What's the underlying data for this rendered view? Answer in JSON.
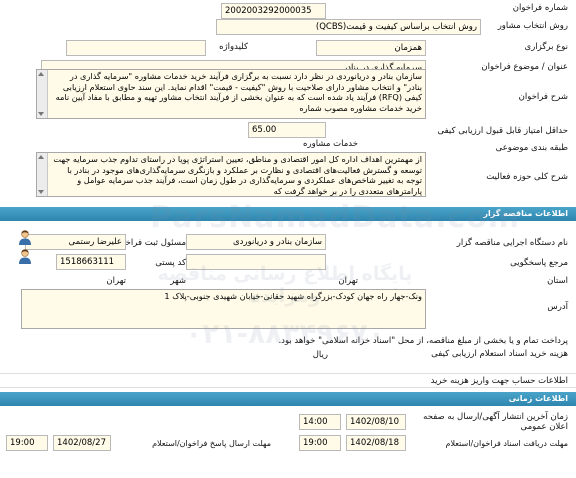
{
  "form": {
    "tender_number": {
      "label": "شماره فراخوان",
      "value": "2002003292000035"
    },
    "consultant_selection": {
      "label": "روش انتخاب مشاور",
      "value": "روش انتخاب براساس کیفیت و قیمت(QCBS)"
    },
    "holding_type": {
      "label": "نوع برگزاری",
      "value": "همزمان",
      "keyword_label": "کلیدواژه",
      "keyword_value": ""
    },
    "title": {
      "label": "عنوان / موضوع فراخوان",
      "value": "سرمایه گذاری در بنادر"
    },
    "description": {
      "label": "شرح فراخوان",
      "text": "سازمان بنادر و دریانوردی در نظر دارد نسبت به برگزاری فرآیند خرید خدمات مشاوره \"سرمایه گذاری در بنادر\" و انتخاب مشاور دارای صلاحیت با روش \"کیفیت - قیمت\" اقدام نماید. این سند حاوی استعلام ارزیابی کیفی (RFQ) فرآیند یاد شده است که به عنوان بخشی از فرآیند انتخاب مشاور تهیه و مطابق با مفاد آیین نامه خرید خدمات مشاوره مصوب شماره"
    },
    "min_quality_score": {
      "label": "حداقل امتیاز قابل قبول ارزیابی کیفی",
      "value": "65.00"
    },
    "subject_class": {
      "label": "طبقه بندی موضوعی",
      "value": "خدمات مشاوره"
    },
    "activity_scope": {
      "label": "شرح کلی حوزه فعالیت",
      "text": "از مهمترین اهداف اداره کل امور اقتصادی و مناطق، تعیین استراتژی پویا در راستای تداوم جذب سرمایه جهت توسعه و گسترش فعالیت‌های اقتصادی و نظارت بر عملکرد و بازنگری سرمایه‌گذاری‌های موجود در بنادر با توجه به تغییر شاخص‌های عملکردی و سرمایه‌گذاری در طول زمان است، فرآیند جذب سرمایه عوامل و پارامترهای متعددی را در بر خواهد گرفت که"
    }
  },
  "organizer": {
    "section_title": "اطلاعات مناقصه گزار",
    "executor": {
      "label": "نام دستگاه اجرایی مناقصه گزار",
      "value": "سازمان بنادر و دریانوردی"
    },
    "official": {
      "label": "مسئول ثبت فراخوان",
      "value": "علیرضا رستمی"
    },
    "reference": {
      "label": "مرجع پاسخگویی",
      "value": ""
    },
    "postal_code": {
      "label": "کد پستی",
      "value": "1518663111"
    },
    "province": {
      "label": "استان",
      "value": "تهران"
    },
    "city": {
      "label": "شهر",
      "value": "تهران"
    },
    "address": {
      "label": "آدرس",
      "value": "ونک-جهار راه جهان کودک-بزرگراه شهید حقانی-خیابان شهیدی جنوبی-پلاک 1"
    }
  },
  "notice": {
    "text": "پرداخت تمام و یا بخشی از مبلغ مناقصه، از محل \"اسناد خزانه اسلامی\" خواهد بود.",
    "cost_label": "هزینه خرید اسناد استعلام ارزیابی کیفی",
    "currency": "ریال",
    "account_label": "اطلاعات حساب جهت واریز هزینه خرید"
  },
  "times": {
    "section_title": "اطلاعات زمانی",
    "publish": {
      "label": "زمان آخرین انتشار آگهی/ارسال به صفحه اعلان عمومی",
      "date": "1402/08/10",
      "time": "14:00"
    },
    "deadline": {
      "label": "مهلت ارسال پاسخ فراخوان/استعلام",
      "date": "1402/08/27",
      "time": "19:00"
    },
    "doc_deadline": {
      "label": "مهلت دریافت اسناد فراخوان/استعلام",
      "date": "1402/08/18",
      "time": "19:00"
    }
  },
  "watermark": {
    "site": "ParsNamadData.com",
    "line1": "پایگاه اطلاع رسانی مناقصه ومزایده",
    "phone": "۰۲۱-۸۸۳۴۹۶۷۰"
  }
}
